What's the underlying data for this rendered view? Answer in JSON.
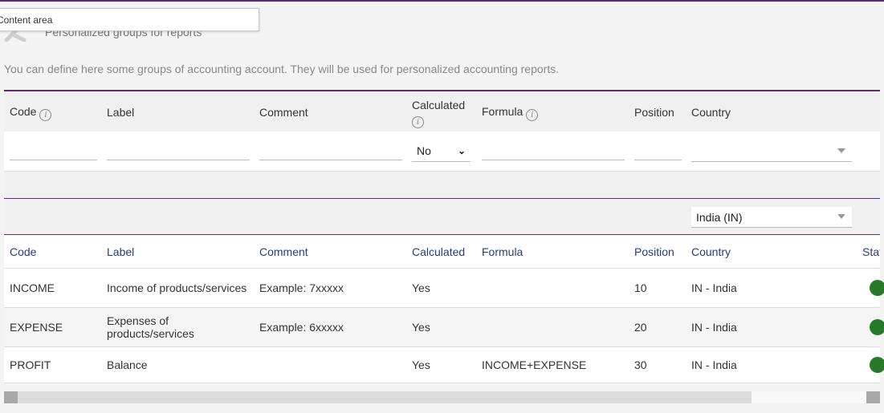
{
  "tooltip": "Content area",
  "page": {
    "title": "Personalized groups for reports",
    "description": "You can define here some groups of accounting account. They will be used for personalized accounting reports."
  },
  "filter_header": {
    "code": "Code",
    "label": "Label",
    "comment": "Comment",
    "calculated_line1": "Calculated",
    "formula": "Formula",
    "position": "Position",
    "country": "Country"
  },
  "filters": {
    "calculated_value": "No",
    "code_value": "",
    "label_value": "",
    "comment_value": "",
    "formula_value": "",
    "position_value": "",
    "country_value": ""
  },
  "country_select": "India (IN)",
  "columns": {
    "code": "Code",
    "label": "Label",
    "comment": "Comment",
    "calculated": "Calculated",
    "formula": "Formula",
    "position": "Position",
    "country": "Country",
    "status": "Status"
  },
  "rows": [
    {
      "code": "INCOME",
      "label": "Income of products/services",
      "comment": "Example: 7xxxxx",
      "calculated": "Yes",
      "formula": "",
      "position": "10",
      "country": "IN - India"
    },
    {
      "code": "EXPENSE",
      "label_line1": "Expenses of",
      "label_line2": "products/services",
      "comment": "Example: 6xxxxx",
      "calculated": "Yes",
      "formula": "",
      "position": "20",
      "country": "IN - India"
    },
    {
      "code": "PROFIT",
      "label": "Balance",
      "comment": "",
      "calculated": "Yes",
      "formula": "INCOME+EXPENSE",
      "position": "30",
      "country": "IN - India"
    }
  ],
  "colors": {
    "accent": "#5a2d6e",
    "link": "#263c81",
    "status_on": "#267a2a"
  }
}
